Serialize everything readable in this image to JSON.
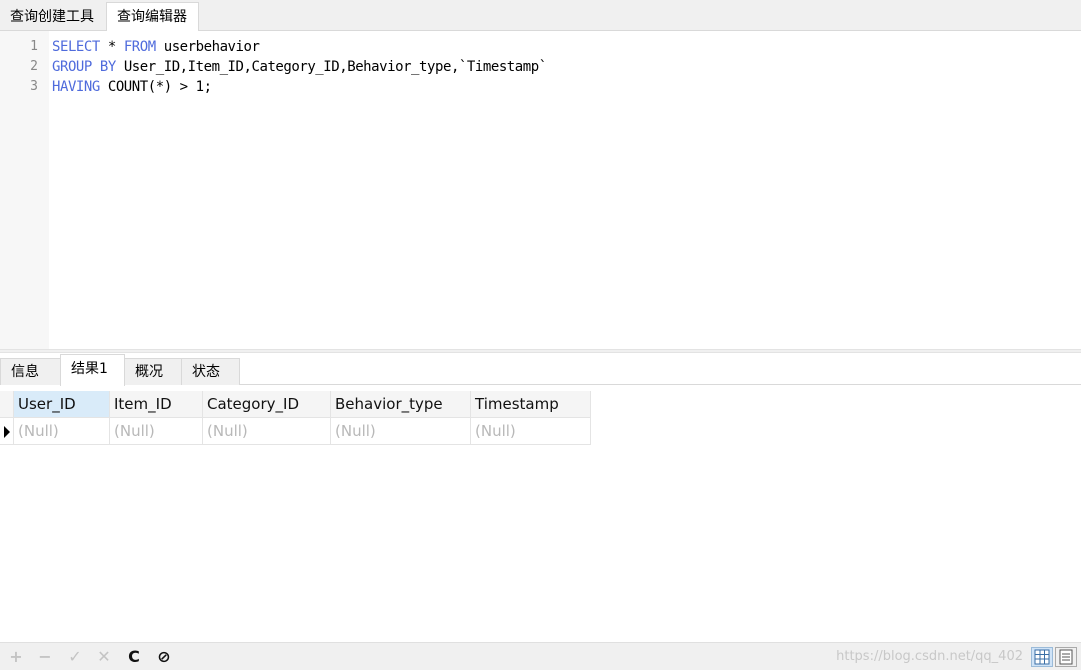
{
  "top_tabs": [
    "查询创建工具",
    "查询编辑器"
  ],
  "editor": {
    "line_numbers": [
      "1",
      "2",
      "3"
    ],
    "lines": [
      [
        {
          "t": "SELECT",
          "k": true
        },
        {
          "t": " * ",
          "k": false
        },
        {
          "t": "FROM",
          "k": true
        },
        {
          "t": " userbehavior",
          "k": false
        }
      ],
      [
        {
          "t": "GROUP BY",
          "k": true
        },
        {
          "t": " User_ID,Item_ID,Category_ID,Behavior_type,`Timestamp`",
          "k": false
        }
      ],
      [
        {
          "t": "HAVING",
          "k": true
        },
        {
          "t": " COUNT(*) > 1;",
          "k": false
        }
      ]
    ]
  },
  "result_tabs": [
    "信息",
    "结果1",
    "概况",
    "状态"
  ],
  "grid": {
    "columns": [
      "User_ID",
      "Item_ID",
      "Category_ID",
      "Behavior_type",
      "Timestamp"
    ],
    "rows": [
      [
        "(Null)",
        "(Null)",
        "(Null)",
        "(Null)",
        "(Null)"
      ]
    ]
  },
  "toolbar": {
    "add": "+",
    "remove": "−",
    "apply": "✓",
    "discard": "✕",
    "refresh": "C",
    "stop": "⊘",
    "watermark": "https://blog.csdn.net/qq_402"
  },
  "colors": {
    "keyword": "#4f6bdc",
    "null_text": "#b8b8b8",
    "selected_header": "#d9ebf9"
  }
}
